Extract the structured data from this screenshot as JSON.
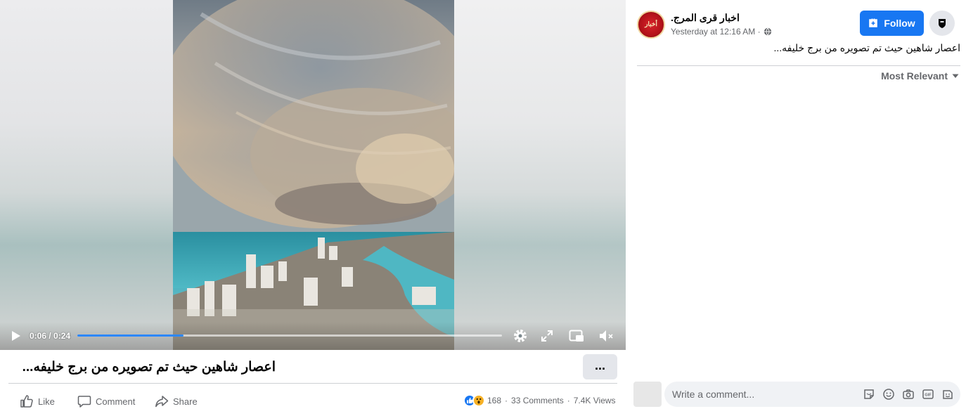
{
  "video": {
    "time_display": "0:06 / 0:24",
    "progress_fraction": 0.25
  },
  "post": {
    "title": "اعصار شاهين حيث تم تصويره من برج خليفه...",
    "more_label": "...",
    "actions": {
      "like": "Like",
      "comment": "Comment",
      "share": "Share"
    },
    "stats": {
      "reactions": "168",
      "comments": "33 Comments",
      "views": "7.4K Views",
      "separator": "·"
    }
  },
  "page": {
    "name": "اخبار قرى المرج.",
    "avatar_text": "أخبار",
    "timestamp": "Yesterday at 12:16 AM ·",
    "follow_label": "Follow",
    "post_text": "اعصار شاهين حيث تم تصويره من برج خليفه..."
  },
  "comments": {
    "sort_label": "Most Relevant",
    "input_placeholder": "Write a comment..."
  },
  "colors": {
    "accent": "#1877f2",
    "secondary_text": "#65676b",
    "button_gray": "#e4e6eb"
  },
  "icons": [
    "play-icon",
    "settings-icon",
    "expand-icon",
    "pip-icon",
    "mute-icon",
    "like-icon",
    "comment-icon",
    "share-icon",
    "globe-icon",
    "follow-icon",
    "shield-icon",
    "caret-down-icon",
    "sticker-icon",
    "emoji-icon",
    "camera-icon",
    "gif-icon",
    "avatar-sticker-icon"
  ]
}
